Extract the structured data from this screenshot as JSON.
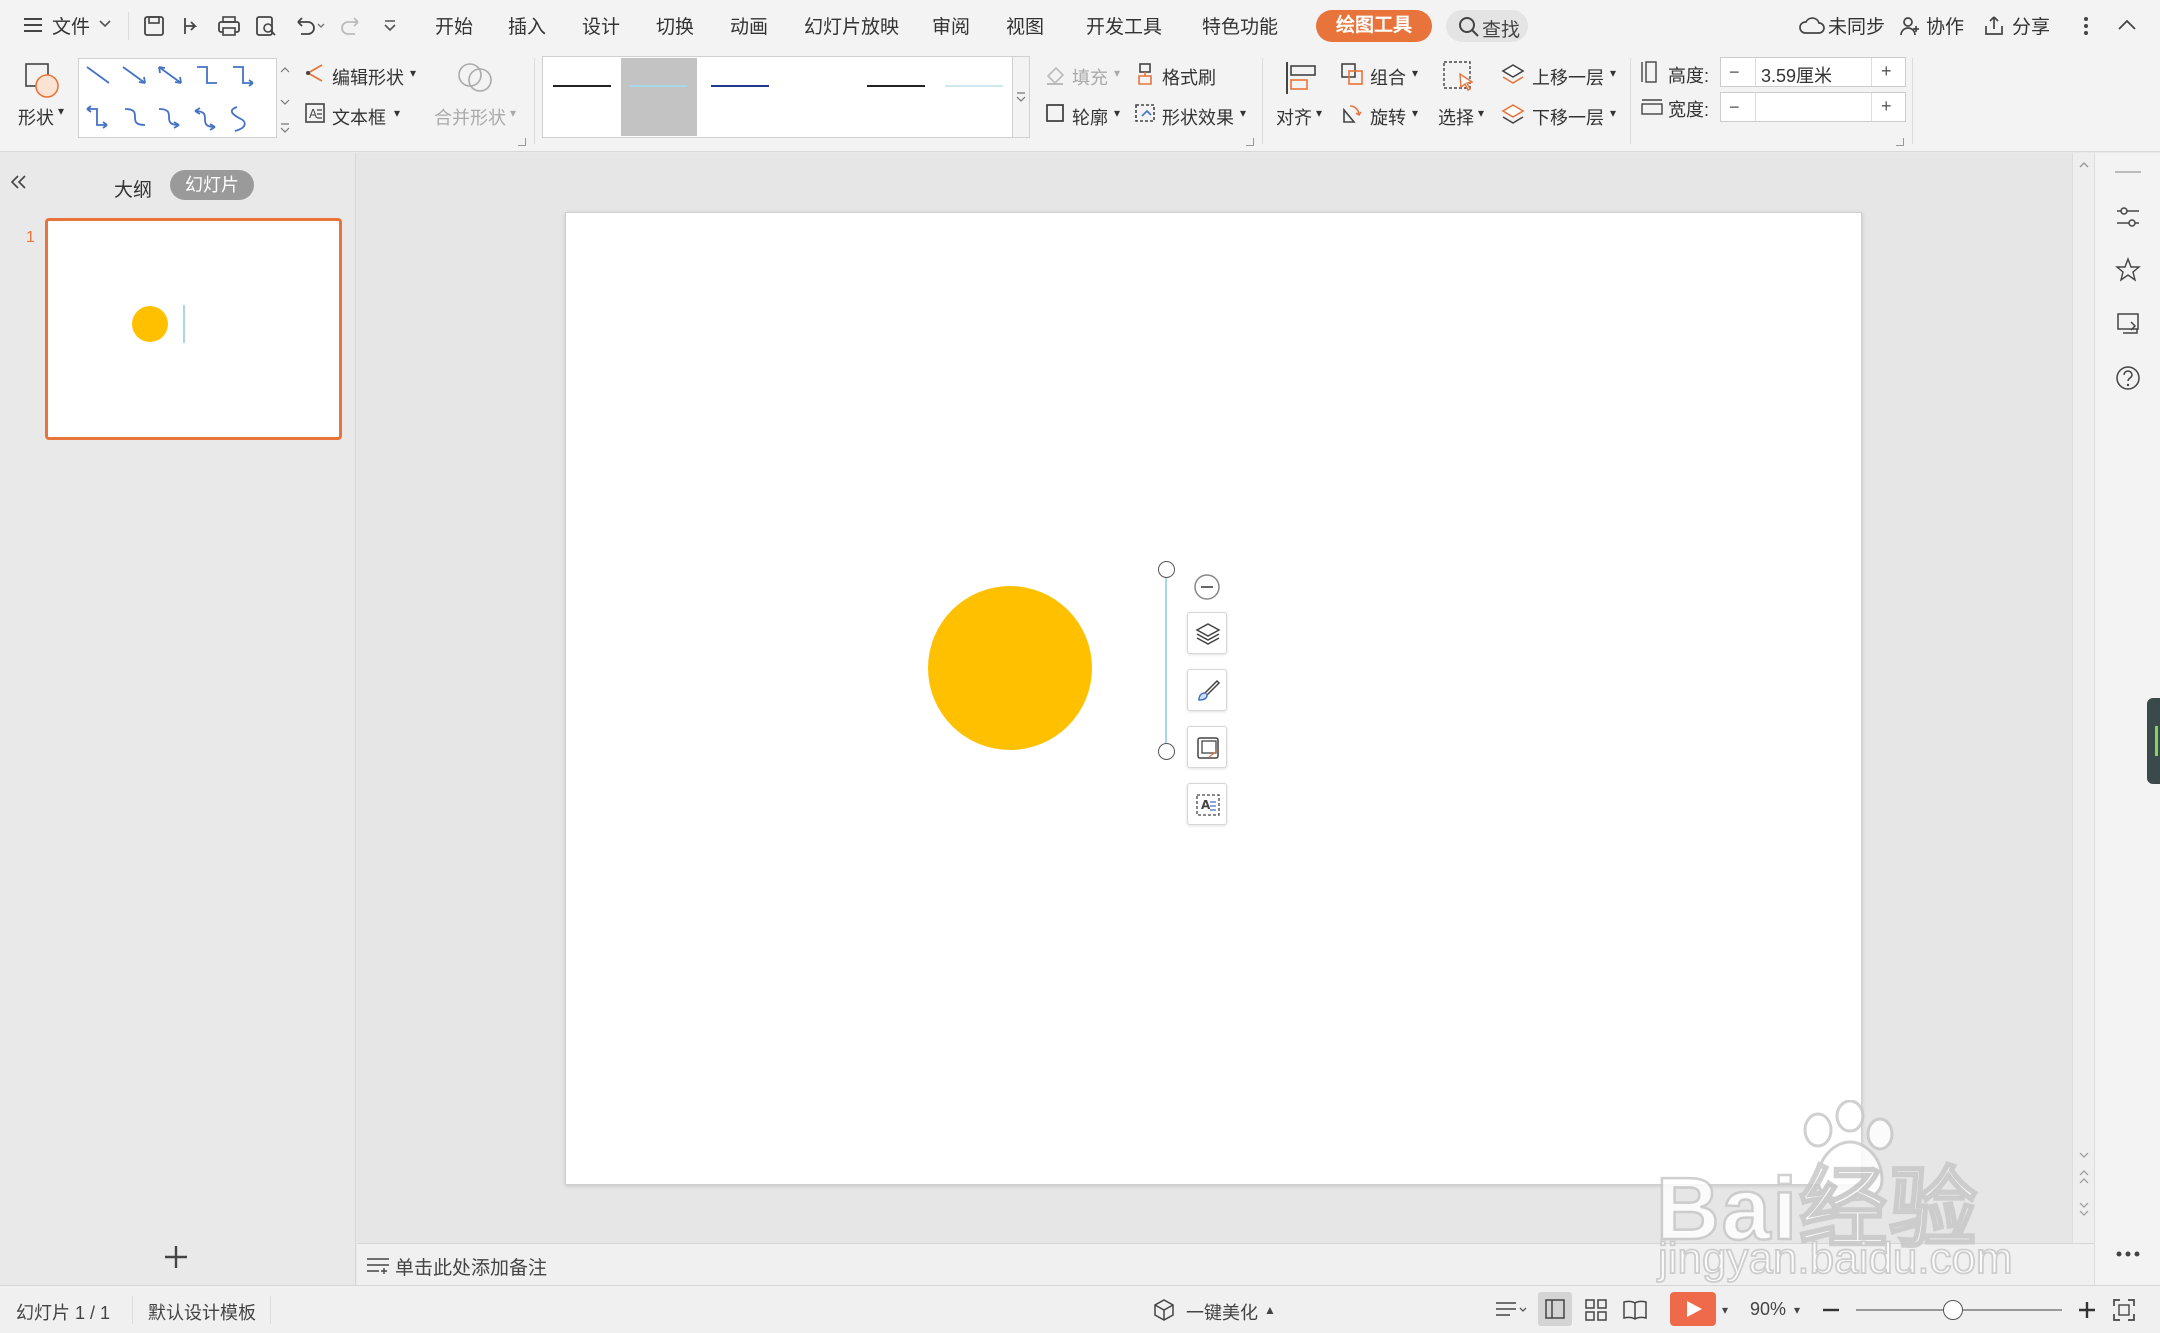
{
  "menubar": {
    "file_label": "文件",
    "tabs": [
      "开始",
      "插入",
      "设计",
      "切换",
      "动画",
      "幻灯片放映",
      "审阅",
      "视图",
      "开发工具",
      "特色功能"
    ],
    "active_tab": "绘图工具",
    "search_label": "查找",
    "sync_label": "未同步",
    "collab_label": "协作",
    "share_label": "分享"
  },
  "ribbon": {
    "shape_label": "形状",
    "edit_shape_label": "编辑形状",
    "textbox_label": "文本框",
    "merge_shape_label": "合并形状",
    "fill_label": "填充",
    "format_painter_label": "格式刷",
    "outline_label": "轮廓",
    "shape_effect_label": "形状效果",
    "align_label": "对齐",
    "group_label": "组合",
    "rotate_label": "旋转",
    "select_label": "选择",
    "bring_forward_label": "上移一层",
    "send_backward_label": "下移一层",
    "height_label": "高度:",
    "height_value": "3.59厘米",
    "width_label": "宽度:",
    "width_value": "",
    "minus": "−",
    "plus": "+"
  },
  "leftpanel": {
    "outline_tab": "大纲",
    "slides_tab": "幻灯片",
    "slide_number": "1"
  },
  "notes": {
    "placeholder": "单击此处添加备注"
  },
  "statusbar": {
    "slide_info": "幻灯片 1 / 1",
    "template": "默认设计模板",
    "beautify": "一键美化",
    "zoom": "90%"
  },
  "colors": {
    "accent": "#e8743b",
    "circle": "#ffc000",
    "line_blue": "#4472c4"
  },
  "watermark": {
    "brand": "Bai经验",
    "url": "jingyan.baidu.com"
  }
}
